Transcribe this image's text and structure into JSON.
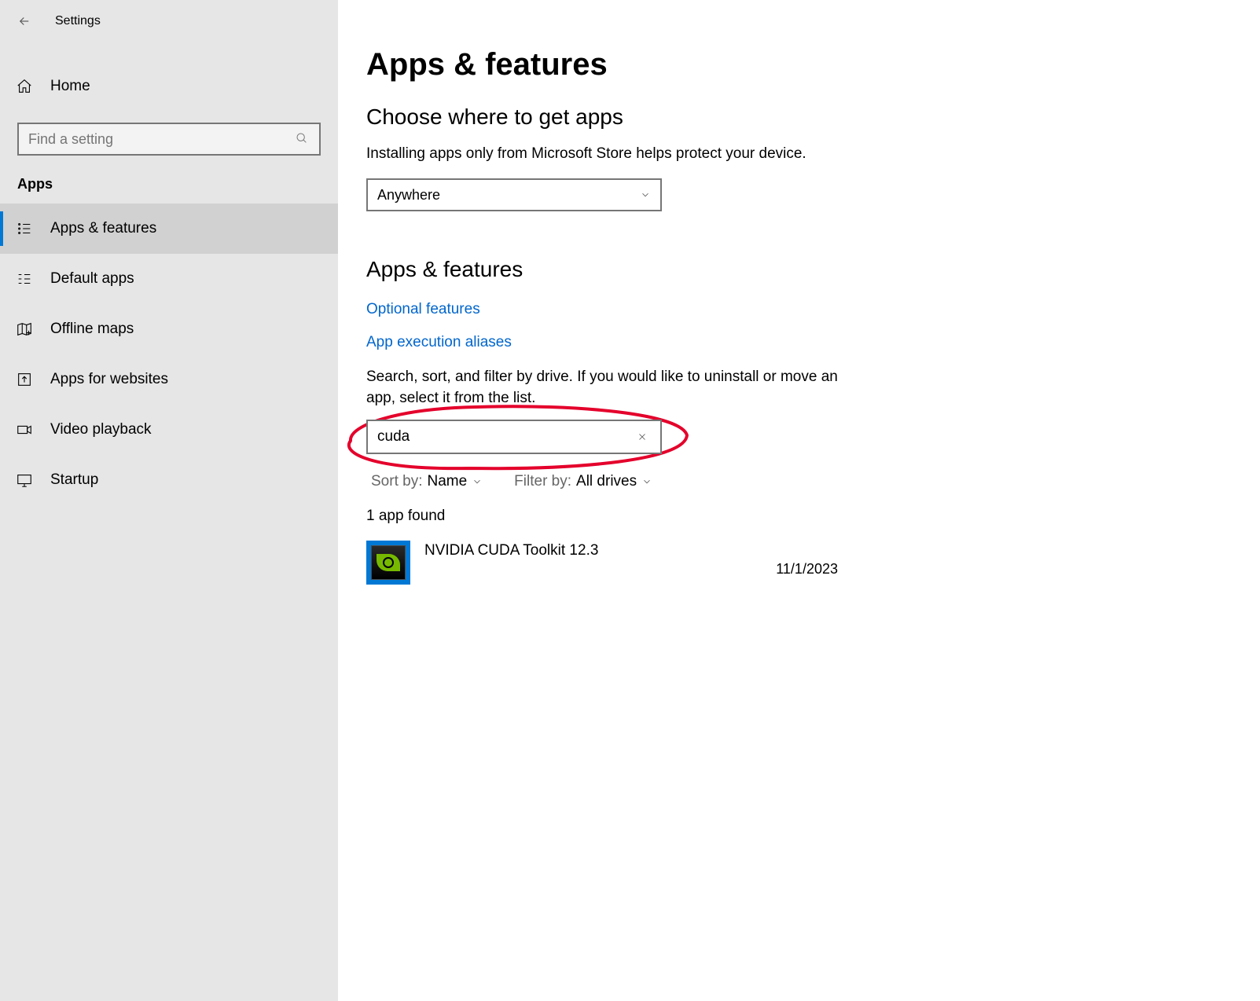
{
  "header": {
    "title": "Settings"
  },
  "sidebar": {
    "home_label": "Home",
    "search_placeholder": "Find a setting",
    "section_label": "Apps",
    "items": [
      {
        "label": "Apps & features",
        "active": true
      },
      {
        "label": "Default apps"
      },
      {
        "label": "Offline maps"
      },
      {
        "label": "Apps for websites"
      },
      {
        "label": "Video playback"
      },
      {
        "label": "Startup"
      }
    ]
  },
  "main": {
    "title": "Apps & features",
    "choose_heading": "Choose where to get apps",
    "choose_text": "Installing apps only from Microsoft Store helps protect your device.",
    "source_dropdown_value": "Anywhere",
    "section2_title": "Apps & features",
    "link_optional": "Optional features",
    "link_aliases": "App execution aliases",
    "search_helper": "Search, sort, and filter by drive. If you would like to uninstall or move an app, select it from the list.",
    "app_search_value": "cuda",
    "sort_label": "Sort by:",
    "sort_value": "Name",
    "filter_label": "Filter by:",
    "filter_value": "All drives",
    "found_text": "1 app found",
    "app_result": {
      "name": "NVIDIA CUDA Toolkit 12.3",
      "date": "11/1/2023"
    }
  }
}
